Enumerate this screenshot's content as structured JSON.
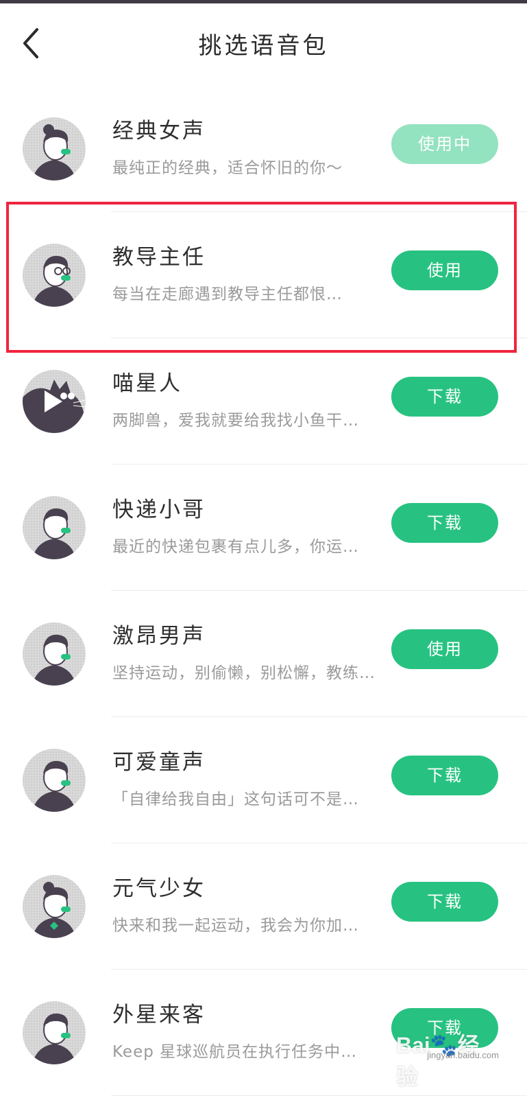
{
  "header": {
    "title": "挑选语音包",
    "back_icon": "chevron-left-icon"
  },
  "voices": [
    {
      "key": "classic-female",
      "name": "经典女声",
      "desc": "最纯正的经典，适合怀旧的你～",
      "action": "使用中",
      "state": "in-use",
      "avatar_icon": "woman-avatar-icon"
    },
    {
      "key": "dean",
      "name": "教导主任",
      "desc": "每当在走廊遇到教导主任都恨…",
      "action": "使用",
      "state": "use",
      "avatar_icon": "glasses-man-avatar-icon"
    },
    {
      "key": "cat",
      "name": "喵星人",
      "desc": "两脚兽，爱我就要给我找小鱼干…",
      "action": "下载",
      "state": "download",
      "avatar_icon": "cat-avatar-icon"
    },
    {
      "key": "courier",
      "name": "快递小哥",
      "desc": "最近的快递包裹有点儿多，你运…",
      "action": "下载",
      "state": "download",
      "avatar_icon": "courier-avatar-icon"
    },
    {
      "key": "passionate-male",
      "name": "激昂男声",
      "desc": "坚持运动，别偷懒，别松懈，教练…",
      "action": "使用",
      "state": "use",
      "avatar_icon": "man-avatar-icon"
    },
    {
      "key": "child",
      "name": "可爱童声",
      "desc": "「自律给我自由」这句话可不是…",
      "action": "下载",
      "state": "download",
      "avatar_icon": "child-avatar-icon"
    },
    {
      "key": "girl",
      "name": "元气少女",
      "desc": "快来和我一起运动，我会为你加…",
      "action": "下载",
      "state": "download",
      "avatar_icon": "girl-avatar-icon"
    },
    {
      "key": "alien",
      "name": "外星来客",
      "desc": "Keep 星球巡航员在执行任务中…",
      "action": "下载",
      "state": "download",
      "avatar_icon": "alien-avatar-icon"
    }
  ],
  "watermark": {
    "logo": "Bai🐾经验",
    "sub": "jingyan.baidu.com"
  },
  "colors": {
    "accent": "#27c281",
    "accent_disabled": "#93e2c0",
    "highlight": "#f0243f",
    "avatar_dark": "#4a4150",
    "avatar_bg": "#d9d9d9"
  }
}
